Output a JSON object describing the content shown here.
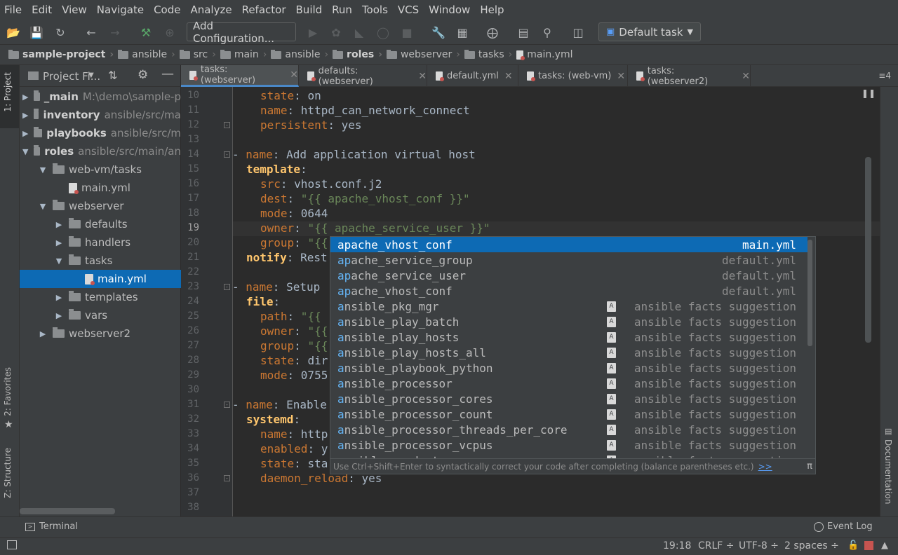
{
  "menu": [
    "File",
    "Edit",
    "View",
    "Navigate",
    "Code",
    "Analyze",
    "Refactor",
    "Build",
    "Run",
    "Tools",
    "VCS",
    "Window",
    "Help"
  ],
  "toolbar": {
    "add_configuration": "Add Configuration...",
    "default_task": "Default task"
  },
  "breadcrumbs": [
    "sample-project",
    "ansible",
    "src",
    "main",
    "ansible",
    "roles",
    "webserver",
    "tasks",
    "main.yml"
  ],
  "left_tools": {
    "project": "1: Project",
    "favorites": "2: Favorites",
    "structure": "Z: Structure"
  },
  "project_panel": {
    "title": "Project Fi...",
    "tree": [
      {
        "name": "_main",
        "extra": "M:\\demo\\sample-p"
      },
      {
        "name": "inventory",
        "extra": "ansible/src/ma"
      },
      {
        "name": "playbooks",
        "extra": "ansible/src/m"
      },
      {
        "name": "roles",
        "extra": "ansible/src/main/an"
      },
      {
        "name": "web-vm/tasks"
      },
      {
        "name": "main.yml"
      },
      {
        "name": "webserver"
      },
      {
        "name": "defaults"
      },
      {
        "name": "handlers"
      },
      {
        "name": "tasks"
      },
      {
        "name": "main.yml"
      },
      {
        "name": "templates"
      },
      {
        "name": "vars"
      },
      {
        "name": "webserver2"
      }
    ]
  },
  "tabs": [
    "tasks: (webserver)",
    "defaults: (webserver)",
    "default.yml",
    "tasks: (web-vm)",
    "tasks: (webserver2)"
  ],
  "tabs_more": "≡4",
  "line_numbers": [
    "10",
    "11",
    "12",
    "13",
    "14",
    "15",
    "16",
    "17",
    "18",
    "19",
    "20",
    "21",
    "22",
    "23",
    "24",
    "25",
    "26",
    "27",
    "28",
    "29",
    "30",
    "31",
    "32",
    "33",
    "34",
    "35",
    "36",
    "37",
    "38"
  ],
  "code": {
    "l10": [
      "state",
      ": ",
      "on"
    ],
    "l11": [
      "name",
      ": ",
      "httpd_can_network_connect"
    ],
    "l12": [
      "persistent",
      ": ",
      "yes"
    ],
    "l14": [
      "- ",
      "name",
      ": ",
      "Add application virtual host"
    ],
    "l15": [
      "template",
      ":"
    ],
    "l16": [
      "src",
      ": ",
      "vhost.conf.j2"
    ],
    "l17": [
      "dest",
      ": ",
      "\"{{ apache_vhost_conf }}\""
    ],
    "l18": [
      "mode",
      ": ",
      "0644"
    ],
    "l19": [
      "owner",
      ": ",
      "\"{{ apache_service_user }}\""
    ],
    "l20": [
      "group",
      ": ",
      "\"{{"
    ],
    "l21": [
      "notify",
      ": ",
      "Rest"
    ],
    "l23": [
      "- ",
      "name",
      ": ",
      "Setup"
    ],
    "l24": [
      "file",
      ":"
    ],
    "l25": [
      "path",
      ": ",
      "\"{{"
    ],
    "l26": [
      "owner",
      ": ",
      "\"{{"
    ],
    "l27": [
      "group",
      ": ",
      "\"{{"
    ],
    "l28": [
      "state",
      ": ",
      "dir"
    ],
    "l29": [
      "mode",
      ": ",
      "0755"
    ],
    "l31": [
      "- ",
      "name",
      ": ",
      "Enable"
    ],
    "l32": [
      "systemd",
      ":"
    ],
    "l33": [
      "name",
      ": ",
      "http"
    ],
    "l34": [
      "enabled",
      ": ",
      "y"
    ],
    "l35": [
      "state",
      ": ",
      "sta"
    ],
    "l36": [
      "daemon_reload",
      ": ",
      "yes"
    ]
  },
  "completion": {
    "items": [
      {
        "prefix": "ap",
        "rest": "ache_vhost_conf",
        "source": "main.yml",
        "icon": false
      },
      {
        "prefix": "ap",
        "rest": "ache_service_group",
        "source": "default.yml",
        "icon": false
      },
      {
        "prefix": "ap",
        "rest": "ache_service_user",
        "source": "default.yml",
        "icon": false
      },
      {
        "prefix": "ap",
        "rest": "ache_vhost_conf",
        "source": "default.yml",
        "icon": false
      },
      {
        "prefix": "a",
        "rest": "nsible_pkg_mgr",
        "source": "ansible facts suggestion",
        "icon": true
      },
      {
        "prefix": "a",
        "rest": "nsible_play_batch",
        "source": "ansible facts suggestion",
        "icon": true
      },
      {
        "prefix": "a",
        "rest": "nsible_play_hosts",
        "source": "ansible facts suggestion",
        "icon": true
      },
      {
        "prefix": "a",
        "rest": "nsible_play_hosts_all",
        "source": "ansible facts suggestion",
        "icon": true
      },
      {
        "prefix": "a",
        "rest": "nsible_playbook_python",
        "source": "ansible facts suggestion",
        "icon": true
      },
      {
        "prefix": "a",
        "rest": "nsible_processor",
        "source": "ansible facts suggestion",
        "icon": true
      },
      {
        "prefix": "a",
        "rest": "nsible_processor_cores",
        "source": "ansible facts suggestion",
        "icon": true
      },
      {
        "prefix": "a",
        "rest": "nsible_processor_count",
        "source": "ansible facts suggestion",
        "icon": true
      },
      {
        "prefix": "a",
        "rest": "nsible_processor_threads_per_core",
        "source": "ansible facts suggestion",
        "icon": true
      },
      {
        "prefix": "a",
        "rest": "nsible_processor_vcpus",
        "source": "ansible facts suggestion",
        "icon": true
      },
      {
        "prefix": "a",
        "rest": "nsible_product_name",
        "source": "ansible facts suggestion",
        "icon": true
      }
    ],
    "hint": "Use Ctrl+Shift+Enter to syntactically correct your code after completing (balance parentheses etc.)",
    "hint_link": ">>",
    "pi": "π"
  },
  "right_tools": {
    "documentation": "Documentation"
  },
  "bottom_tools": {
    "terminal": "Terminal",
    "event_log": "Event Log"
  },
  "status": {
    "position": "19:18",
    "line_sep": "CRLF ÷",
    "encoding": "UTF-8 ÷",
    "indent": "2 spaces ÷"
  }
}
